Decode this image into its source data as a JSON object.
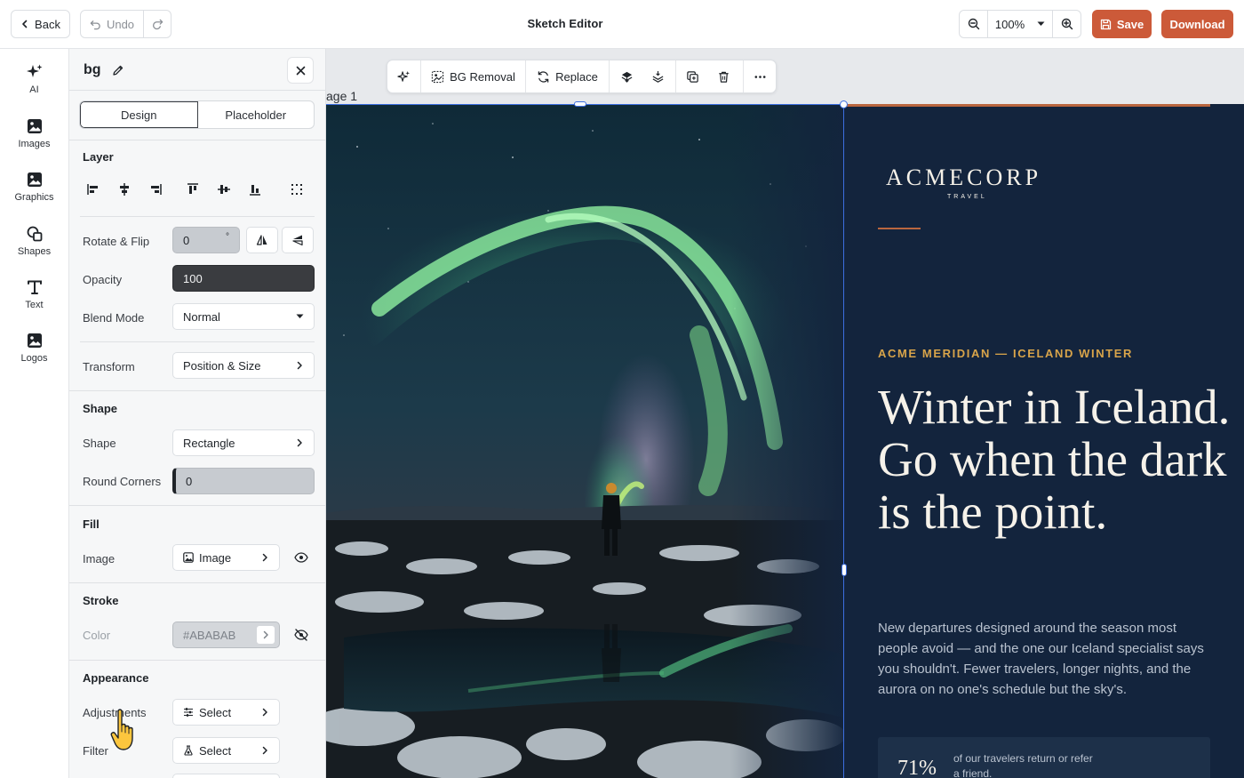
{
  "topbar": {
    "back_label": "Back",
    "undo_label": "Undo",
    "title": "Sketch Editor",
    "zoom_value": "100%",
    "save_label": "Save",
    "download_label": "Download",
    "accent_color": "#cc5a39"
  },
  "rail": {
    "items": [
      {
        "label": "AI",
        "icon": "sparkle-icon"
      },
      {
        "label": "Images",
        "icon": "image-icon"
      },
      {
        "label": "Graphics",
        "icon": "graphic-icon"
      },
      {
        "label": "Shapes",
        "icon": "shapes-icon"
      },
      {
        "label": "Text",
        "icon": "text-icon"
      },
      {
        "label": "Logos",
        "icon": "logo-icon"
      }
    ]
  },
  "panel": {
    "layer_name": "bg",
    "tabs": [
      "Design",
      "Placeholder"
    ],
    "active_tab": "Design",
    "layer_title": "Layer",
    "rotate_label": "Rotate & Flip",
    "rotate_value": "0",
    "rotate_unit": "°",
    "opacity_label": "Opacity",
    "opacity_value": "100",
    "blend_label": "Blend Mode",
    "blend_value": "Normal",
    "transform_label": "Transform",
    "transform_value": "Position & Size",
    "shape_title": "Shape",
    "shape_label": "Shape",
    "shape_value": "Rectangle",
    "round_label": "Round Corners",
    "round_value": "0",
    "fill_title": "Fill",
    "fill_image_label": "Image",
    "fill_image_value": "Image",
    "stroke_title": "Stroke",
    "stroke_color_label": "Color",
    "stroke_color_value": "#ABABAB",
    "appearance_title": "Appearance",
    "adjustments_label": "Adjustments",
    "adjustments_value": "Select",
    "filter_label": "Filter",
    "filter_value": "Select"
  },
  "canvas": {
    "page_label": "age 1",
    "toolbar": {
      "bg_removal": "BG Removal",
      "replace": "Replace"
    },
    "design": {
      "logo_word": "ACMECORP",
      "logo_sub": "TRAVEL",
      "eyebrow": "ACME MERIDIAN — ICELAND WINTER",
      "headline": "Winter in Iceland. Go when the dark is the point.",
      "body": "New departures designed around the season most people avoid — and the one our Iceland specialist says you shouldn't. Fewer travelers, longer nights, and the aurora on no one's schedule but the sky's.",
      "stat_value": "71%",
      "stat_text": "of our travelers return or refer a friend.",
      "navy_color": "#13243d",
      "gold_color": "#d8a44a"
    }
  }
}
